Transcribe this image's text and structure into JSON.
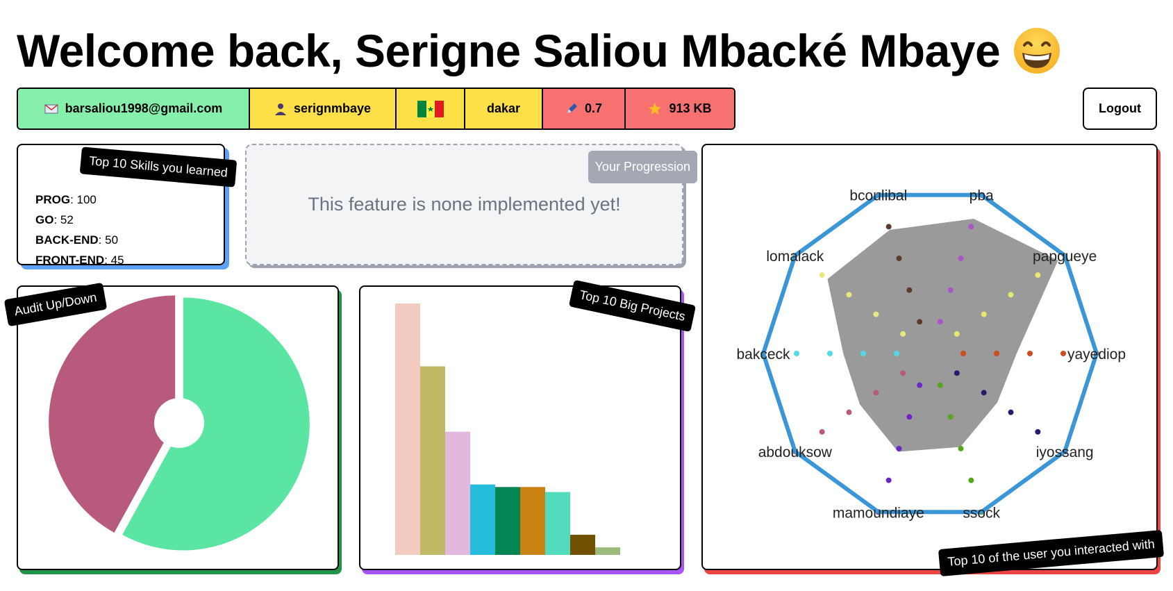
{
  "header": {
    "welcome": "Welcome back, Serigne Saliou Mbacké Mbaye",
    "emoji": "grinning-face-emoji"
  },
  "info": {
    "email": "barsaliou1998@gmail.com",
    "username": "serignmbaye",
    "flag": "senegal-flag",
    "city": "dakar",
    "ratio": "0.7",
    "xp": "913 KB"
  },
  "logout_label": "Logout",
  "colors": {
    "green": "#86efac",
    "yellow": "#fde047",
    "red": "#f87171",
    "pie_down": "#b85a7d",
    "pie_up": "#5ae6a2",
    "radar_outline": "#3a96d6",
    "radar_fill": "#9a9a9a"
  },
  "skills": {
    "tag": "Top 10 Skills you learned",
    "items": [
      {
        "name": "PROG",
        "value": ": 100"
      },
      {
        "name": "GO",
        "value": ": 52"
      },
      {
        "name": "BACK-END",
        "value": ": 50"
      },
      {
        "name": "FRONT-END",
        "value": ": 45"
      }
    ]
  },
  "progression": {
    "badge": "Your Progression",
    "message": "This feature is none implemented yet!"
  },
  "audit": {
    "tag": "Audit Up/Down",
    "chart_data": {
      "type": "pie",
      "slices": [
        {
          "name": "",
          "value": 0.58,
          "color": "#5ae6a2"
        },
        {
          "name": "",
          "value": 0.42,
          "color": "#b85a7d"
        }
      ]
    }
  },
  "projects": {
    "tag": "Top 10 Big Projects",
    "chart_data": {
      "type": "bar",
      "values": [
        100,
        75,
        49,
        28,
        27,
        27,
        25,
        8,
        3,
        0
      ],
      "colors": [
        "#f4cbc0",
        "#c0b864",
        "#e2b8df",
        "#26bddc",
        "#038654",
        "#c98211",
        "#52dbbd",
        "#715000",
        "#9cba7c",
        "#b8b808"
      ]
    }
  },
  "users": {
    "tag": "Top 10 of the user you interacted with",
    "chart_data": {
      "type": "radar",
      "axes": [
        "pba",
        "papgueye",
        "yayediop",
        "iyossang",
        "ssock",
        "mamoundiaye",
        "abdouksow",
        "bakceck",
        "lomalack",
        "bcoulibal"
      ],
      "values": [
        0.85,
        0.95,
        0.52,
        0.5,
        0.59,
        0.62,
        0.52,
        0.52,
        0.76,
        0.78
      ],
      "dot_colors": [
        "#a855c8",
        "#e8e870",
        "#cc4d1b",
        "#2a1a6c",
        "#5aa51e",
        "#6c26c8",
        "#b85a7d",
        "#52dbe8",
        "#e8e880",
        "#5a3a2a"
      ]
    }
  }
}
